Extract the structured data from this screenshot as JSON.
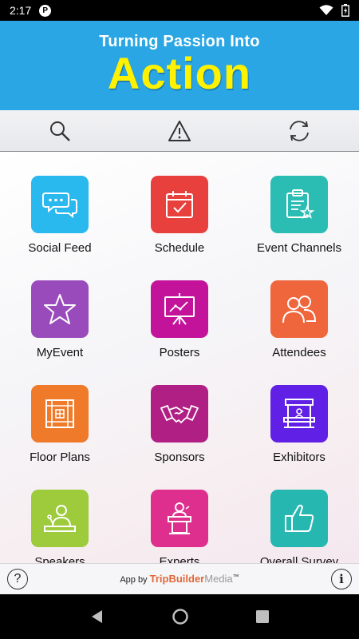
{
  "status_bar": {
    "time": "2:17",
    "app_badge": "P"
  },
  "banner": {
    "line1": "Turning Passion Into",
    "line2": "Action"
  },
  "toolbar": {
    "icons": [
      "search-icon",
      "alert-icon",
      "refresh-icon"
    ]
  },
  "tiles": [
    {
      "label": "Social Feed",
      "color": "#29b9ef",
      "icon": "chat-bubbles-icon"
    },
    {
      "label": "Schedule",
      "color": "#e8403c",
      "icon": "calendar-check-icon"
    },
    {
      "label": "Event Channels",
      "color": "#2bbdb4",
      "icon": "clipboard-star-icon"
    },
    {
      "label": "MyEvent",
      "color": "#9a4bbb",
      "icon": "star-icon"
    },
    {
      "label": "Posters",
      "color": "#c3139a",
      "icon": "presentation-board-icon"
    },
    {
      "label": "Attendees",
      "color": "#f0663c",
      "icon": "people-icon"
    },
    {
      "label": "Floor Plans",
      "color": "#ef7b2a",
      "icon": "floor-plan-icon"
    },
    {
      "label": "Sponsors",
      "color": "#b01f84",
      "icon": "handshake-icon"
    },
    {
      "label": "Exhibitors",
      "color": "#6120e5",
      "icon": "booth-icon"
    },
    {
      "label": "Speakers",
      "color": "#9dcb3b",
      "icon": "speaker-icon"
    },
    {
      "label": "Experts",
      "color": "#df2f8e",
      "icon": "podium-icon"
    },
    {
      "label": "Overall Survey",
      "color": "#27b7b1",
      "icon": "thumbs-up-icon"
    }
  ],
  "footer": {
    "app_by": "App by",
    "brand_primary": "TripBuilder",
    "brand_secondary": "Media",
    "trademark": "™",
    "help_label": "?",
    "info_label": "i"
  }
}
